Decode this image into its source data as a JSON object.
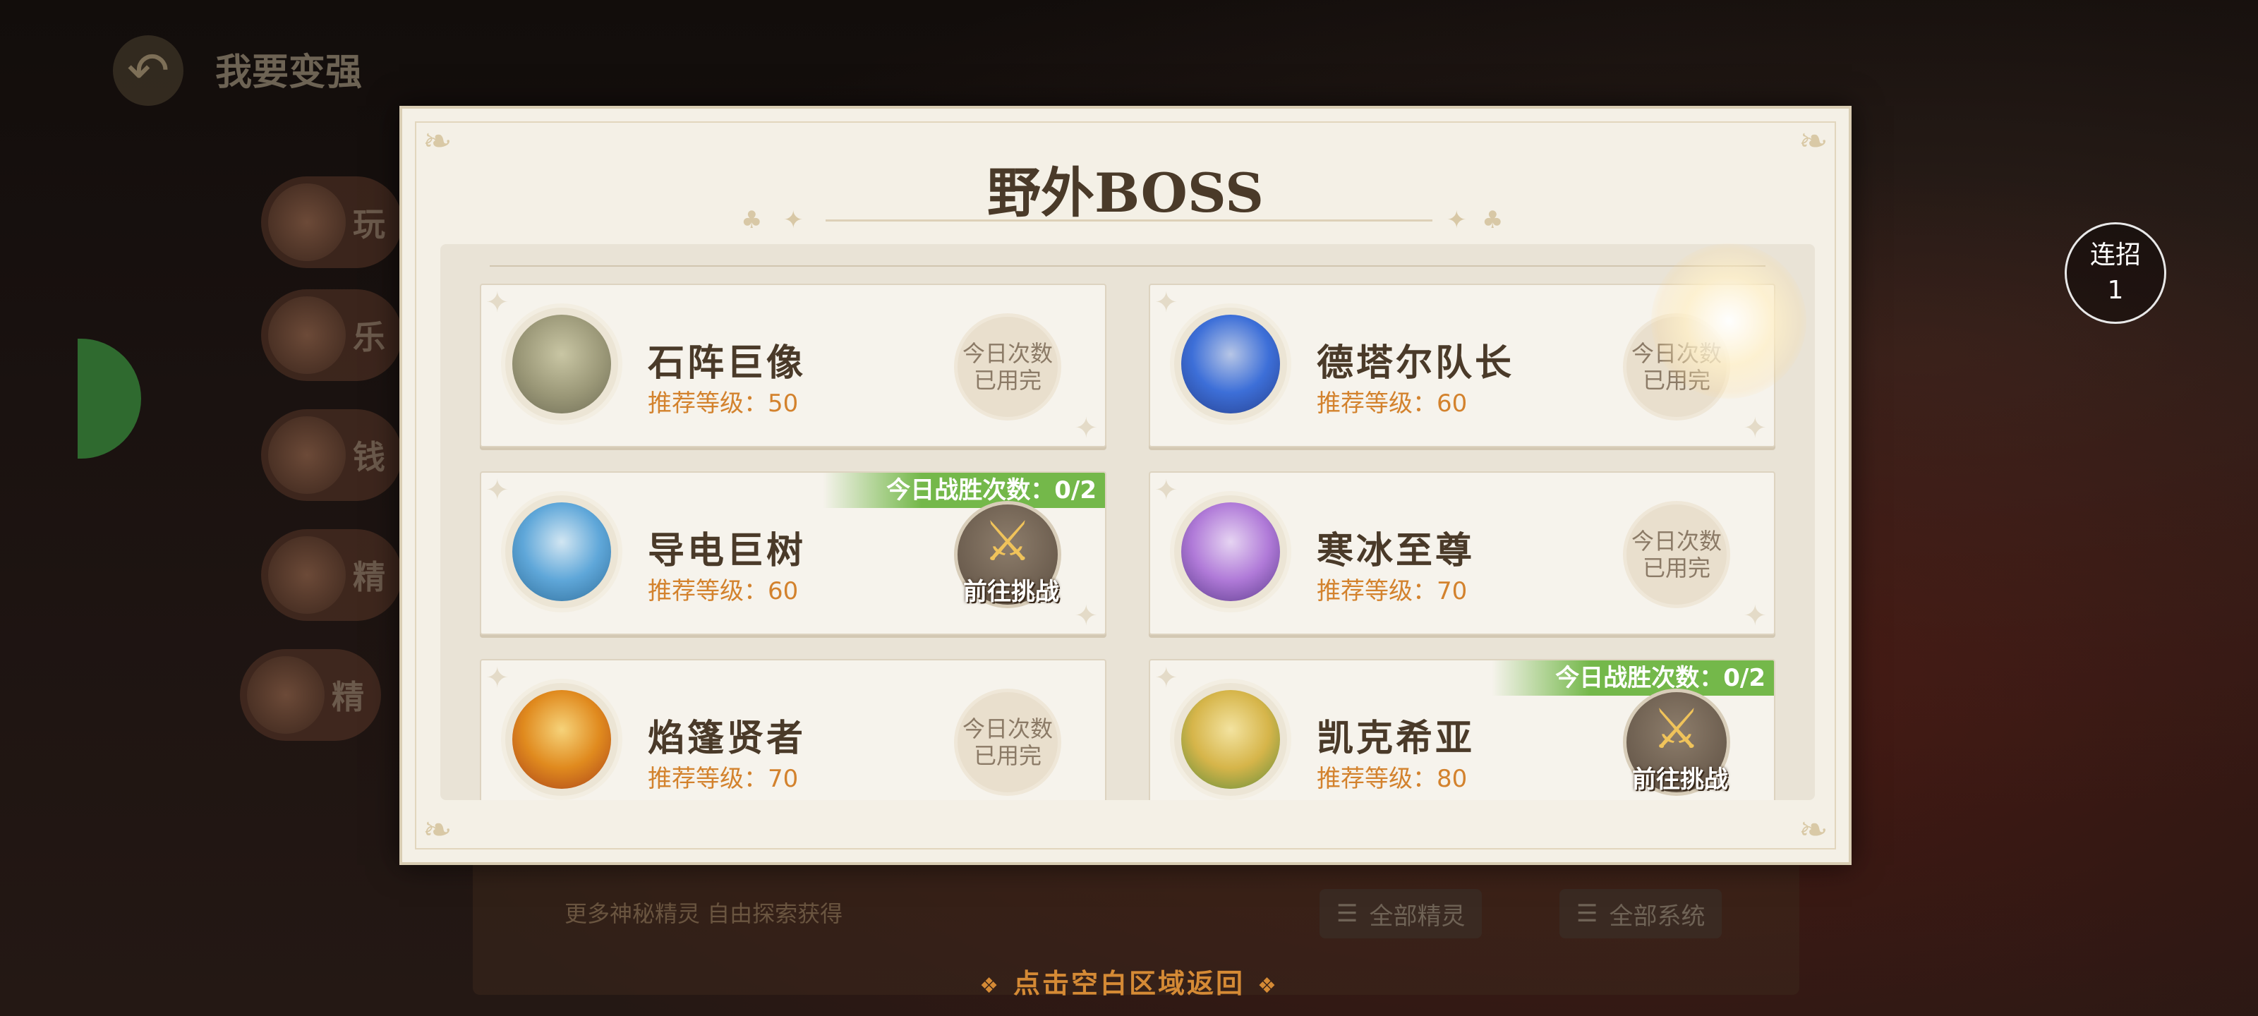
{
  "background": {
    "back_title": "我要变强",
    "side_menu": [
      "玩",
      "乐",
      "钱",
      "精",
      "精"
    ],
    "footer_note": "更多神秘精灵 自由探索获得",
    "all_sprites_label": "全部精灵",
    "all_systems_label": "全部系统"
  },
  "combo_badge": {
    "label": "连招",
    "count": "1"
  },
  "dialog": {
    "title": "野外BOSS",
    "bosses": [
      {
        "name": "石阵巨像",
        "level": "推荐等级：50",
        "status": "exhausted",
        "status_line1": "今日次数",
        "status_line2": "已用完",
        "color": "#9a9777"
      },
      {
        "name": "德塔尔队长",
        "level": "推荐等级：60",
        "status": "exhausted",
        "status_line1": "今日次数",
        "status_line2": "已用完",
        "color": "#3d6fd8"
      },
      {
        "name": "导电巨树",
        "level": "推荐等级：60",
        "status": "available",
        "win_banner": "今日战胜次数：0/2",
        "button_label": "前往挑战",
        "color": "#5fa7d9"
      },
      {
        "name": "寒冰至尊",
        "level": "推荐等级：70",
        "status": "exhausted",
        "status_line1": "今日次数",
        "status_line2": "已用完",
        "color": "#b07ad8"
      },
      {
        "name": "焰篷贤者",
        "level": "推荐等级：70",
        "status": "exhausted",
        "status_line1": "今日次数",
        "status_line2": "已用完",
        "color": "#e08a1e"
      },
      {
        "name": "凯克希亚",
        "level": "推荐等级：80",
        "status": "available",
        "win_banner": "今日战胜次数：0/2",
        "button_label": "前往挑战",
        "color": "#d6b54a"
      }
    ]
  },
  "hint": "点击空白区域返回",
  "colors": {
    "accent_orange": "#d3822d",
    "win_green": "#74b84a",
    "title_brown": "#4a3a29"
  }
}
